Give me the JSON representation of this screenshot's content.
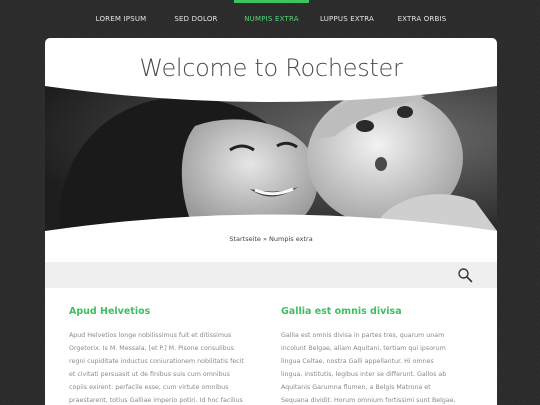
{
  "nav": {
    "items": [
      {
        "label": "LOREM IPSUM",
        "active": false
      },
      {
        "label": "SED DOLOR",
        "active": false
      },
      {
        "label": "NUMPIS EXTRA",
        "active": true
      },
      {
        "label": "LUPPUS EXTRA",
        "active": false
      },
      {
        "label": "EXTRA ORBIS",
        "active": false
      }
    ]
  },
  "page": {
    "title": "Welcome to Rochester",
    "breadcrumb": "Startseite » Numpis extra"
  },
  "search": {
    "icon": "search-icon"
  },
  "columns": [
    {
      "heading": "Apud Helvetios",
      "body": "Apud Helvetios longe nobilissimus fuit et ditissimus Orgetorix. Is M. Messala, [et P.] M. Pisone consulibus regni cupiditate inductus coniurationem nobilitatis fecit et civitati persuasit ut de finibus suis cum omnibus copiis exirent: perfacile esse, cum virtute omnibus praestarent, totius Galliae imperio potiri. Id hoc facilius iis persuasit, quod"
    },
    {
      "heading": "Gallia est omnis divisa",
      "body": "Gallia est omnis divisa in partes tres, quarum unam incolunt Belgae, aliam Aquitani, tertiam qui ipsorum lingua Celtae, nostra Galli appellantur. Hi omnes lingua, institutis, legibus inter se differunt. Gallos ab Aquitanis Garumna flumen, a Belgis Matrona et Sequana dividit. Horum omnium fortissimi sunt Belgae, propterea quod a cultu atque humanitate"
    }
  ],
  "colors": {
    "accent": "#3ec262",
    "background": "#2b2b2b",
    "panel": "#ffffff",
    "search_bar": "#efefef"
  }
}
